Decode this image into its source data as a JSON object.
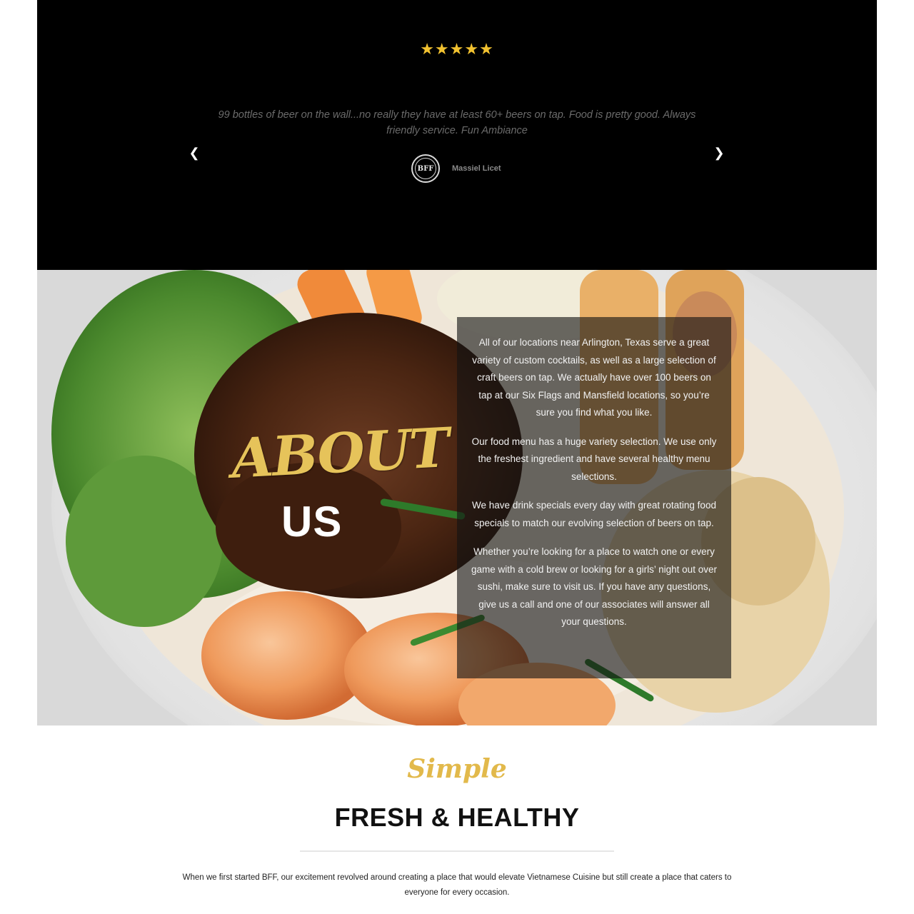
{
  "testimonial": {
    "stars": "★★★★★",
    "rating": 5,
    "quote": "99 bottles of beer on the wall...no really they have at least 60+ beers on tap. Food is pretty good. Always friendly service. Fun Ambiance",
    "author": "Massiel Licet",
    "logo_text": "BFF",
    "prev_icon": "chevron-left-icon",
    "next_icon": "chevron-right-icon",
    "star_color": "#f2c230"
  },
  "about": {
    "script_heading": "ABOUT",
    "heading": "US",
    "paragraphs": [
      "All of our locations near Arlington, Texas serve a great variety of custom cocktails, as well as a large selection of craft beers on tap. We actually have over 100 beers on tap at our Six Flags and Mansfield locations, so you’re sure you find what you like.",
      "Our food menu has a huge variety selection. We  use only the freshest ingredient and have several healthy menu selections.",
      "We have drink specials every day with great rotating food specials to match our evolving selection of beers on tap.",
      "Whether you’re looking for a place to watch one or every game with a cold brew or looking for a girls’ night out over sushi, make sure to visit us. If you have any questions, give us a call and one of our associates will answer all your questions."
    ],
    "accent_color": "#e6c35a"
  },
  "fresh": {
    "script_heading": "Simple",
    "title": "FRESH & HEALTHY",
    "body": "When we first started BFF, our excitement revolved around creating a place that would elevate Vietnamese Cuisine but still create a place that caters to everyone for every occasion."
  }
}
